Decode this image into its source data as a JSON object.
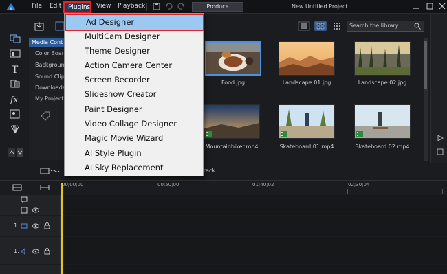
{
  "menubar": {
    "items": [
      "File",
      "Edit",
      "Plugins",
      "View",
      "Playback"
    ],
    "produce_label": "Produce",
    "project_title": "New Untitled Project"
  },
  "plugins_menu": {
    "items": [
      "Ad Designer",
      "MultiCam Designer",
      "Theme Designer",
      "Action Camera Center",
      "Screen Recorder",
      "Slideshow Creator",
      "Paint Designer",
      "Video Collage Designer",
      "Magic Movie Wizard",
      "AI Style Plugin",
      "AI Sky Replacement"
    ]
  },
  "library": {
    "nav_items": [
      "Media Cont",
      "Color Board",
      "Backgroun",
      "Sound Clips",
      "Downloade",
      "My Projects"
    ],
    "search_placeholder": "Search the library",
    "media": [
      {
        "name": "Food.jpg",
        "icon": "image"
      },
      {
        "name": "Landscape 01.jpg",
        "icon": "image"
      },
      {
        "name": "Landscape 02.jpg",
        "icon": "image"
      },
      {
        "name": "Mountainbiker.mp4",
        "icon": "video"
      },
      {
        "name": "Skateboard 01.mp4",
        "icon": "video"
      },
      {
        "name": "Skateboard 02.mp4",
        "icon": "video"
      }
    ],
    "hint_text": "d track."
  },
  "timeline": {
    "ruler_labels": [
      "00;00;00",
      "00;50;00",
      "01;40;02",
      "02;30;04"
    ],
    "tracks": [
      "1.",
      "1."
    ]
  },
  "colors": {
    "accent": "#2c5b9a",
    "highlight_border": "#e0242e",
    "menu_highlight": "#9cc9f2",
    "playhead": "#e6c31a"
  }
}
